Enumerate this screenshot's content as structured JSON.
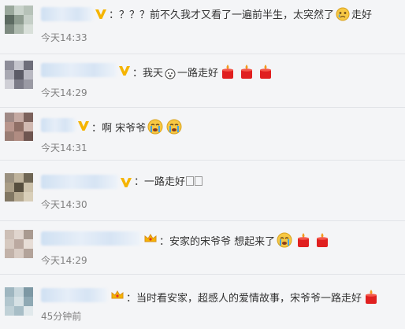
{
  "comments": [
    {
      "text_a": "：？？？前不久我才又看了一遍前半生，太突然了",
      "text_b": "走好",
      "time": "今天14:33",
      "badge": "v-badge",
      "avatar_colors": [
        "#9aa89c",
        "#c9d3cb",
        "#b6c2b8",
        "#5d6b62",
        "#8e9c90",
        "#c5cfc7",
        "#7d8a80",
        "#aebaaf",
        "#d9e0da"
      ],
      "emoji": [
        "crying-face-icon"
      ]
    },
    {
      "text_a": "：我天",
      "text_b": "一路走好",
      "time": "今天14:29",
      "badge": "v-badge",
      "avatar_colors": [
        "#8d8d99",
        "#c4c4cc",
        "#6e6e7a",
        "#a8a8b2",
        "#5b5b66",
        "#b9b9c2",
        "#cfcfd6",
        "#7c7c88",
        "#9a9aa4"
      ],
      "emoji": [
        "candle-icon",
        "candle-icon",
        "candle-icon"
      ]
    },
    {
      "text_a": "：啊 宋爷爷",
      "time": "今天14:31",
      "badge": "v-badge",
      "avatar_colors": [
        "#a08a86",
        "#c4a9a2",
        "#7c625c",
        "#b9968d",
        "#8f6f66",
        "#d1b9b1",
        "#9a7d74",
        "#b08c82",
        "#6e5550"
      ],
      "emoji": [
        "crying-face-icon",
        "crying-face-icon"
      ]
    },
    {
      "text_a": "：一路走好",
      "time": "今天14:30",
      "badge": "v-badge",
      "avatar_colors": [
        "#9b9180",
        "#bfb39c",
        "#6f6654",
        "#a99d86",
        "#564e3e",
        "#cdc2ab",
        "#817763",
        "#b5a990",
        "#d9cfb9"
      ],
      "emoji": []
    },
    {
      "text_a": "：安家的宋爷爷 想起来了",
      "time": "今天14:29",
      "badge": "crown-badge",
      "avatar_colors": [
        "#cdbfb6",
        "#e0d5ce",
        "#a99a90",
        "#d6c9c0",
        "#bba9a0",
        "#e7ddd6",
        "#c2b2a9",
        "#d9ccc4",
        "#b3a39a"
      ],
      "emoji": [
        "crying-face-icon",
        "candle-icon",
        "candle-icon"
      ]
    },
    {
      "text_a": "：当时看安家，超感人的爱情故事，宋爷爷一路走好",
      "time": "45分钟前",
      "badge": "crown-badge",
      "avatar_colors": [
        "#9fb6c0",
        "#c7d6dc",
        "#7d98a4",
        "#b2c6ce",
        "#d6e1e5",
        "#8fa9b4",
        "#c0d1d7",
        "#a8bec7",
        "#e1e9ec"
      ],
      "emoji": [
        "candle-icon"
      ]
    }
  ]
}
